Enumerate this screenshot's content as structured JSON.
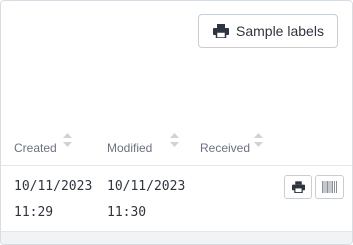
{
  "toolbar": {
    "sample_labels_button": "Sample labels",
    "sample_labels_icon": "printer-icon"
  },
  "table": {
    "columns": [
      {
        "label": "Created",
        "sort_icon": "sort-icon"
      },
      {
        "label": "Modified",
        "sort_icon": "sort-icon"
      },
      {
        "label": "Received",
        "sort_icon": "sort-icon"
      }
    ],
    "rows": [
      {
        "created_date": "10/11/2023",
        "created_time": "11:29",
        "modified_date": "10/11/2023",
        "modified_time": "11:30",
        "actions": [
          {
            "icon": "printer-icon"
          },
          {
            "icon": "barcode-icon"
          }
        ]
      }
    ]
  },
  "colors": {
    "text": "#2f3540",
    "muted": "#6b7280",
    "border": "#c9ced4"
  }
}
